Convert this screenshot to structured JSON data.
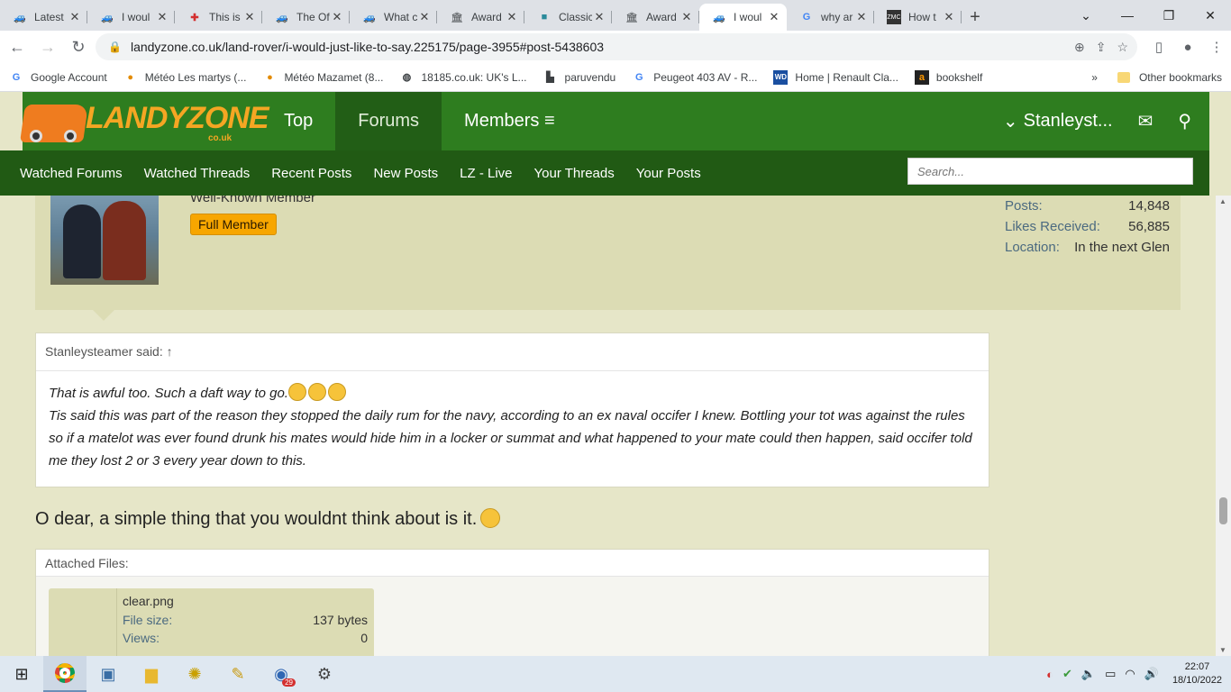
{
  "browser": {
    "tabs": [
      {
        "title": "Latest",
        "icon": "truck-icon"
      },
      {
        "title": "I woul",
        "icon": "truck-icon"
      },
      {
        "title": "This is",
        "icon": "red-cross-icon"
      },
      {
        "title": "The Of",
        "icon": "truck-icon"
      },
      {
        "title": "What c",
        "icon": "truck-icon"
      },
      {
        "title": "Award",
        "icon": "bank-icon"
      },
      {
        "title": "Classic",
        "icon": "folder-icon"
      },
      {
        "title": "Award",
        "icon": "bank-icon"
      },
      {
        "title": "I woul",
        "icon": "truck-icon",
        "active": true
      },
      {
        "title": "why ar",
        "icon": "google-icon"
      },
      {
        "title": "How t",
        "icon": "zmc-icon"
      }
    ],
    "url": "landyzone.co.uk/land-rover/i-would-just-like-to-say.225175/page-3955#post-5438603",
    "bookmarks": [
      {
        "label": "Google Account",
        "icon": "google-icon"
      },
      {
        "label": "Météo Les martys (...",
        "icon": "weather-icon"
      },
      {
        "label": "Météo Mazamet (8...",
        "icon": "weather-icon"
      },
      {
        "label": "18185.co.uk: UK's L...",
        "icon": "globe-icon"
      },
      {
        "label": "paruvendu",
        "icon": "paruvendu-icon"
      },
      {
        "label": "Peugeot 403 AV - R...",
        "icon": "google-icon"
      },
      {
        "label": "Home | Renault Cla...",
        "icon": "wd-icon"
      },
      {
        "label": "bookshelf",
        "icon": "amazon-icon"
      }
    ],
    "other_bookmarks": "Other bookmarks"
  },
  "site": {
    "logo_text": "LANDYZONE",
    "logo_sub": "co.uk",
    "nav": [
      {
        "label": "Top"
      },
      {
        "label": "Forums",
        "active": true
      },
      {
        "label": "Members ≡"
      }
    ],
    "user": "Stanleyst...",
    "subnav": [
      "Watched Forums",
      "Watched Threads",
      "Recent Posts",
      "New Posts",
      "LZ - Live",
      "Your Threads",
      "Your Posts"
    ],
    "search_placeholder": "Search..."
  },
  "post": {
    "user_title": "Well-Known Member",
    "badge": "Full Member",
    "stats": [
      {
        "key": "Posts:",
        "value": "14,848"
      },
      {
        "key": "Likes Received:",
        "value": "56,885"
      },
      {
        "key": "Location:",
        "value": "In the next Glen"
      }
    ],
    "quote_author": "Stanleysteamer said: ↑",
    "quote_line1": "That is awful too. Such a daft way to go.",
    "quote_body": "Tis said this was part of the reason they stopped the daily rum for the navy, according to an ex naval occifer I knew. Bottling your tot was against the rules so if a matelot was ever found drunk his mates would hide him in a locker or summat and what happened to your mate could then happen, said occifer told me they lost 2 or 3 every year down to this.",
    "message": "O dear, a simple thing that you wouldnt think about is it.",
    "attached_label": "Attached Files:",
    "file": {
      "name": "clear.png",
      "size_label": "File size:",
      "size": "137 bytes",
      "views_label": "Views:",
      "views": "0"
    }
  },
  "taskbar": {
    "time": "22:07",
    "date": "18/10/2022",
    "notif_count": "29"
  }
}
